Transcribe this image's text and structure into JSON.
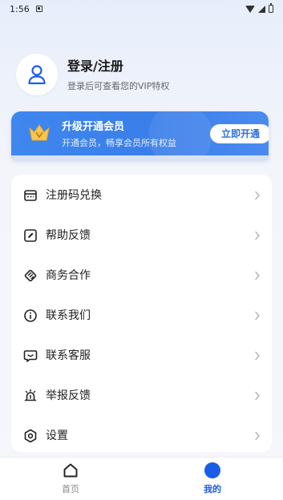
{
  "status_bar": {
    "time": "1:56"
  },
  "profile": {
    "title": "登录/注册",
    "subtitle": "登录后可查看您的VIP特权",
    "icon": "user-icon"
  },
  "vip": {
    "title": "升级开通会员",
    "subtitle": "开通会员，畅享会员所有权益",
    "button": "立即开通",
    "icon": "crown-icon",
    "accent": "#3a7ee9"
  },
  "menu": {
    "items": [
      {
        "label": "注册码兑换",
        "icon": "card-icon"
      },
      {
        "label": "帮助反馈",
        "icon": "edit-icon"
      },
      {
        "label": "商务合作",
        "icon": "handshake-icon"
      },
      {
        "label": "联系我们",
        "icon": "info-icon"
      },
      {
        "label": "联系客服",
        "icon": "chat-icon"
      },
      {
        "label": "举报反馈",
        "icon": "alarm-icon"
      },
      {
        "label": "设置",
        "icon": "settings-icon"
      }
    ]
  },
  "bottom_nav": {
    "home": "首页",
    "mine": "我的",
    "active_color": "#1b5ce6"
  }
}
